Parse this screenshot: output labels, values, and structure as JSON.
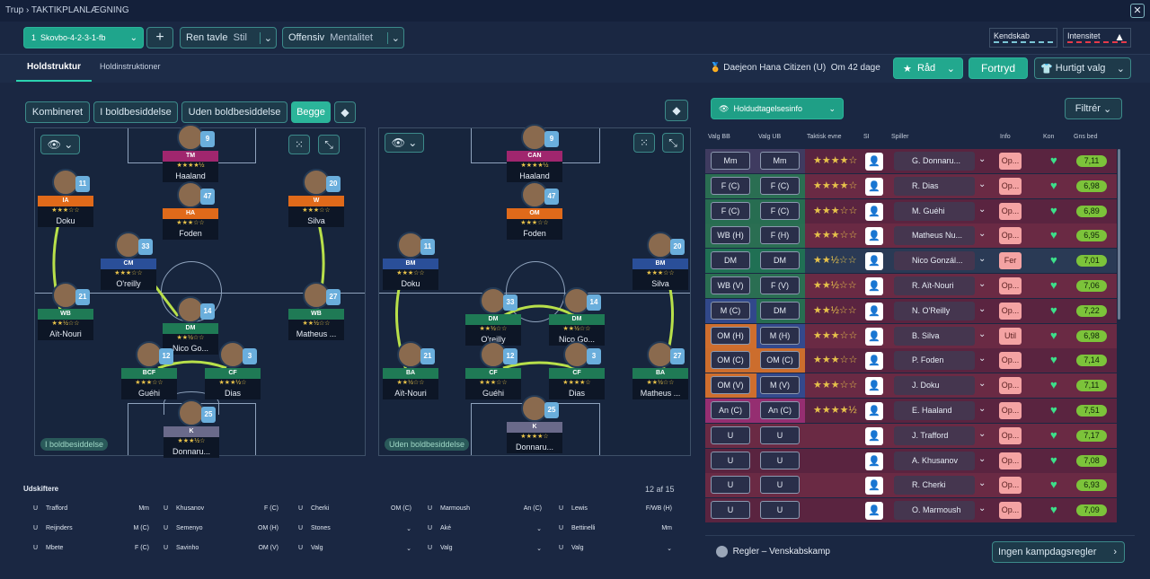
{
  "breadcrumb": {
    "parent": "Trup",
    "current": "TAKTIKPLANLÆGNING"
  },
  "toolbar": {
    "tactic_num": "1",
    "tactic_name": "Skovbo-4-2-3-1-fb",
    "add": "+",
    "style_value": "Ren tavle",
    "style_label": "Stil",
    "mentality_value": "Offensiv",
    "mentality_label": "Mentalitet",
    "familiarity": "Kendskab",
    "intensity": "Intensitet"
  },
  "tabs": [
    "Holdstruktur",
    "Holdinstruktioner"
  ],
  "opponent": {
    "text": "Daejeon Hana Citizen (U)",
    "days": "Om 42 dage"
  },
  "actions": {
    "advice": "Råd",
    "undo": "Fortryd",
    "quick": "Hurtigt valg"
  },
  "phase_tabs": [
    "Kombineret",
    "I boldbesiddelse",
    "Uden boldbesiddelse",
    "Begge"
  ],
  "pitch_labels": {
    "in": "I boldbesiddelse",
    "out": "Uden boldbesiddelse"
  },
  "pitch_in": [
    {
      "pos": "TM",
      "color": "#a0266e",
      "name": "Haaland",
      "num": "9",
      "stars": "★★★★½"
    },
    {
      "pos": "IA",
      "color": "#e06a1a",
      "name": "Doku",
      "num": "11",
      "stars": "★★★☆☆"
    },
    {
      "pos": "HA",
      "color": "#e06a1a",
      "name": "Foden",
      "num": "47",
      "stars": "★★★☆☆"
    },
    {
      "pos": "W",
      "color": "#e06a1a",
      "name": "Silva",
      "num": "20",
      "stars": "★★★☆☆"
    },
    {
      "pos": "CM",
      "color": "#2a4f99",
      "name": "O'reilly",
      "num": "33",
      "stars": "★★★☆☆"
    },
    {
      "pos": "WB",
      "color": "#1f7a55",
      "name": "Aït-Nouri",
      "num": "21",
      "stars": "★★½☆☆"
    },
    {
      "pos": "DM",
      "color": "#1f7a55",
      "name": "Nico Go...",
      "num": "14",
      "stars": "★★½☆☆"
    },
    {
      "pos": "WB",
      "color": "#1f7a55",
      "name": "Matheus ...",
      "num": "27",
      "stars": "★★½☆☆"
    },
    {
      "pos": "BCF",
      "color": "#1f7a55",
      "name": "Guéhi",
      "num": "12",
      "stars": "★★★☆☆"
    },
    {
      "pos": "CF",
      "color": "#1f7a55",
      "name": "Dias",
      "num": "3",
      "stars": "★★★½☆"
    },
    {
      "pos": "K",
      "color": "#6a6a8a",
      "name": "Donnaru...",
      "num": "25",
      "stars": "★★★½☆"
    }
  ],
  "pitch_out": [
    {
      "pos": "CAN",
      "color": "#a0266e",
      "name": "Haaland",
      "num": "9",
      "stars": "★★★★½"
    },
    {
      "pos": "OM",
      "color": "#e06a1a",
      "name": "Foden",
      "num": "47",
      "stars": "★★★☆☆"
    },
    {
      "pos": "BM",
      "color": "#2a4f99",
      "name": "Doku",
      "num": "11",
      "stars": "★★★☆☆"
    },
    {
      "pos": "BM",
      "color": "#2a4f99",
      "name": "Silva",
      "num": "20",
      "stars": "★★★☆☆"
    },
    {
      "pos": "DM",
      "color": "#1f7a55",
      "name": "O'reilly",
      "num": "33",
      "stars": "★★½☆☆"
    },
    {
      "pos": "DM",
      "color": "#1f7a55",
      "name": "Nico Go...",
      "num": "14",
      "stars": "★★½☆☆"
    },
    {
      "pos": "BA",
      "color": "#1f7a55",
      "name": "Aït-Nouri",
      "num": "21",
      "stars": "★★½☆☆"
    },
    {
      "pos": "CF",
      "color": "#1f7a55",
      "name": "Guéhi",
      "num": "12",
      "stars": "★★★☆☆"
    },
    {
      "pos": "CF",
      "color": "#1f7a55",
      "name": "Dias",
      "num": "3",
      "stars": "★★★★☆"
    },
    {
      "pos": "BA",
      "color": "#1f7a55",
      "name": "Matheus ...",
      "num": "27",
      "stars": "★★½☆☆"
    },
    {
      "pos": "K",
      "color": "#6a6a8a",
      "name": "Donnaru...",
      "num": "25",
      "stars": "★★★★☆"
    }
  ],
  "subs": {
    "title": "Udskiftere",
    "count": "12 af 15",
    "rows": [
      [
        [
          "U",
          "Trafford",
          "Mm"
        ],
        [
          "U",
          "Khusanov",
          "F (C)"
        ],
        [
          "U",
          "Cherki",
          "OM (C)"
        ],
        [
          "U",
          "Marmoush",
          "An (C)"
        ],
        [
          "U",
          "Lewis",
          "F/WB (H)"
        ]
      ],
      [
        [
          "U",
          "Reijnders",
          "M (C)"
        ],
        [
          "U",
          "Semenyo",
          "OM (H)"
        ],
        [
          "U",
          "Stones",
          ""
        ],
        [
          "U",
          "Aké",
          ""
        ],
        [
          "U",
          "Bettinelli",
          "Mm"
        ]
      ],
      [
        [
          "U",
          "Mbete",
          "F (C)"
        ],
        [
          "U",
          "Savinho",
          "OM (V)"
        ],
        [
          "U",
          "Valg",
          ""
        ],
        [
          "U",
          "Valg",
          ""
        ],
        [
          "U",
          "Valg",
          ""
        ]
      ]
    ]
  },
  "panel": {
    "dropdown": "Holdudtagelsesinfo",
    "filter": "Filtrér",
    "headers": [
      "Valg BB",
      "Valg UB",
      "Taktisk evne",
      "SI",
      "Spiller",
      "Info",
      "Kon",
      "Gns bed"
    ],
    "rows": [
      {
        "bb": "Mm",
        "ub": "Mm",
        "stars": "★★★★☆",
        "name": "G. Donnaru...",
        "info": "Op...",
        "rating": "7,11"
      },
      {
        "bb": "F (C)",
        "ub": "F (C)",
        "stars": "★★★★☆",
        "name": "R. Dias",
        "info": "Op...",
        "rating": "6,98"
      },
      {
        "bb": "F (C)",
        "ub": "F (C)",
        "stars": "★★★☆☆",
        "name": "M. Guéhi",
        "info": "Op...",
        "rating": "6,89"
      },
      {
        "bb": "WB (H)",
        "ub": "F (H)",
        "stars": "★★★☆☆",
        "name": "Matheus Nu...",
        "info": "Op...",
        "rating": "6,95"
      },
      {
        "bb": "DM",
        "ub": "DM",
        "stars": "★★½☆☆",
        "name": "Nico Gonzál...",
        "info": "Fer",
        "rating": "7,01"
      },
      {
        "bb": "WB (V)",
        "ub": "F (V)",
        "stars": "★★½☆☆",
        "name": "R. Aït-Nouri",
        "info": "Op...",
        "rating": "7,06"
      },
      {
        "bb": "M (C)",
        "ub": "DM",
        "stars": "★★½☆☆",
        "name": "N. O'Reilly",
        "info": "Op...",
        "rating": "7,22"
      },
      {
        "bb": "OM (H)",
        "ub": "M (H)",
        "stars": "★★★☆☆",
        "name": "B. Silva",
        "info": "Util",
        "rating": "6,98"
      },
      {
        "bb": "OM (C)",
        "ub": "OM (C)",
        "stars": "★★★☆☆",
        "name": "P. Foden",
        "info": "Op...",
        "rating": "7,14"
      },
      {
        "bb": "OM (V)",
        "ub": "M (V)",
        "stars": "★★★☆☆",
        "name": "J. Doku",
        "info": "Op...",
        "rating": "7,11"
      },
      {
        "bb": "An (C)",
        "ub": "An (C)",
        "stars": "★★★★½",
        "name": "E. Haaland",
        "info": "Op...",
        "rating": "7,51"
      },
      {
        "bb": "U",
        "ub": "U",
        "stars": "",
        "name": "J. Trafford",
        "info": "Op...",
        "rating": "7,17"
      },
      {
        "bb": "U",
        "ub": "U",
        "stars": "",
        "name": "A. Khusanov",
        "info": "Op...",
        "rating": "7,08"
      },
      {
        "bb": "U",
        "ub": "U",
        "stars": "",
        "name": "R. Cherki",
        "info": "Op...",
        "rating": "6,93"
      },
      {
        "bb": "U",
        "ub": "U",
        "stars": "",
        "name": "O. Marmoush",
        "info": "Op...",
        "rating": "7,09"
      }
    ],
    "rules": "Regler – Venskabskamp",
    "matchday": "Ingen kampdagsregler"
  }
}
